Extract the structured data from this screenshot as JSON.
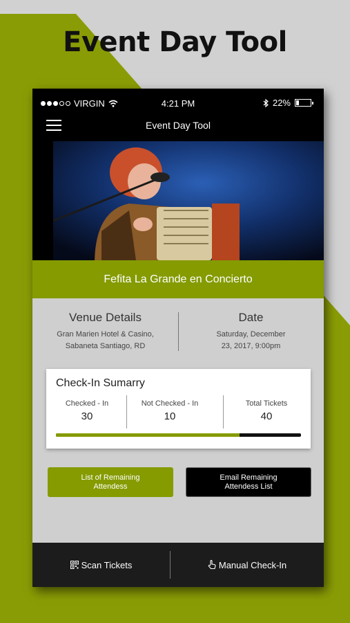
{
  "promo": {
    "title": "Event Day Tool"
  },
  "status_bar": {
    "carrier": "VIRGIN",
    "time": "4:21 PM",
    "battery": "22%",
    "battery_level": 0.22
  },
  "nav": {
    "title": "Event Day Tool"
  },
  "event": {
    "name": "Fefita La Grande en Concierto"
  },
  "venue": {
    "heading": "Venue Details",
    "line1": "Gran Marien Hotel & Casino,",
    "line2": "Sabaneta Santiago, RD"
  },
  "date": {
    "heading": "Date",
    "line1": "Saturday, December",
    "line2": "23, 2017, 9:00pm"
  },
  "summary": {
    "title": "Check-In Sumarry",
    "checked_in_label": "Checked - In",
    "checked_in_value": "30",
    "not_checked_label": "Not Checked - In",
    "not_checked_value": "10",
    "total_label": "Total Tickets",
    "total_value": "40",
    "progress_fraction": 0.75
  },
  "buttons": {
    "remaining_line1": "List of Remaining",
    "remaining_line2": "Attendess",
    "email_line1": "Email Remaining",
    "email_line2": "Attendess List"
  },
  "bottom": {
    "scan": "Scan Tickets",
    "manual": "Manual Check-In"
  },
  "colors": {
    "accent": "#859b00",
    "dark": "#000000"
  }
}
